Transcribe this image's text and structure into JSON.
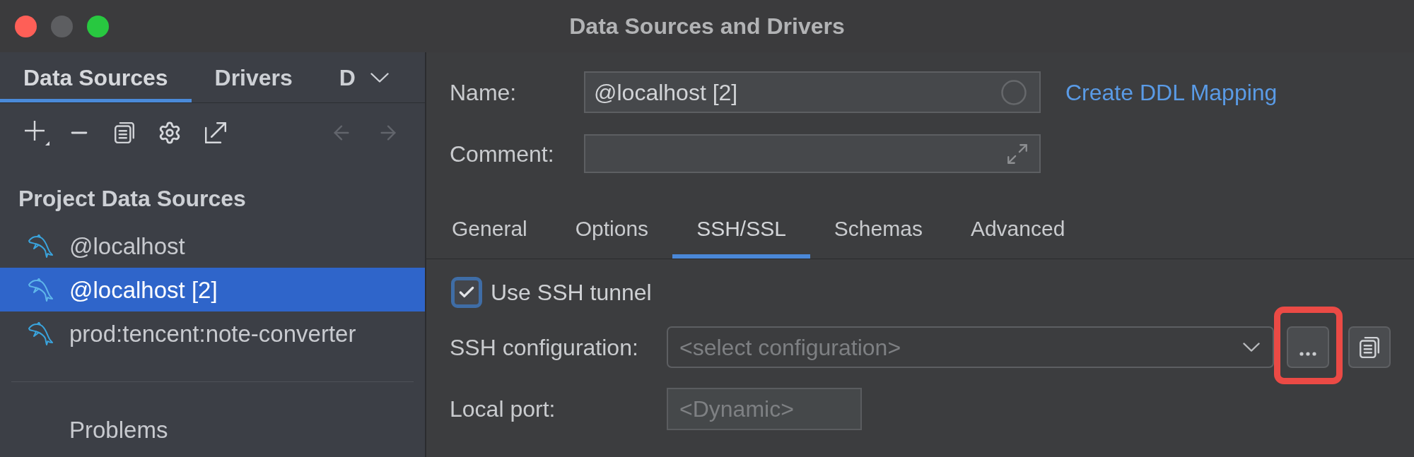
{
  "window": {
    "title": "Data Sources and Drivers",
    "controls": [
      {
        "kind": "close",
        "disabled": false
      },
      {
        "kind": "minimize",
        "disabled": true
      },
      {
        "kind": "zoom",
        "disabled": false
      }
    ]
  },
  "sidebar": {
    "tabs": [
      {
        "label": "Data Sources",
        "selected": true
      },
      {
        "label": "Drivers",
        "selected": false
      },
      {
        "label": "D",
        "selected": false
      }
    ],
    "toolbar": {
      "back_disabled": true,
      "forward_disabled": true
    },
    "section_title": "Project Data Sources",
    "items": [
      {
        "label": "@localhost",
        "selected": false
      },
      {
        "label": "@localhost [2]",
        "selected": true
      },
      {
        "label": "prod:tencent:note-converter",
        "selected": false
      }
    ],
    "footer_item": "Problems"
  },
  "form": {
    "name": {
      "label": "Name:",
      "value": "@localhost [2]"
    },
    "link": "Create DDL Mapping",
    "comment": {
      "label": "Comment:"
    }
  },
  "tabs": [
    {
      "label": "General",
      "selected": false
    },
    {
      "label": "Options",
      "selected": false
    },
    {
      "label": "SSH/SSL",
      "selected": true
    },
    {
      "label": "Schemas",
      "selected": false
    },
    {
      "label": "Advanced",
      "selected": false
    }
  ],
  "ssh": {
    "use_tunnel": {
      "label": "Use SSH tunnel",
      "checked": true
    },
    "configuration": {
      "label": "SSH configuration:",
      "placeholder": "<select configuration>",
      "browse_highlighted": true
    },
    "local_port": {
      "label": "Local port:",
      "placeholder": "<Dynamic>"
    }
  }
}
